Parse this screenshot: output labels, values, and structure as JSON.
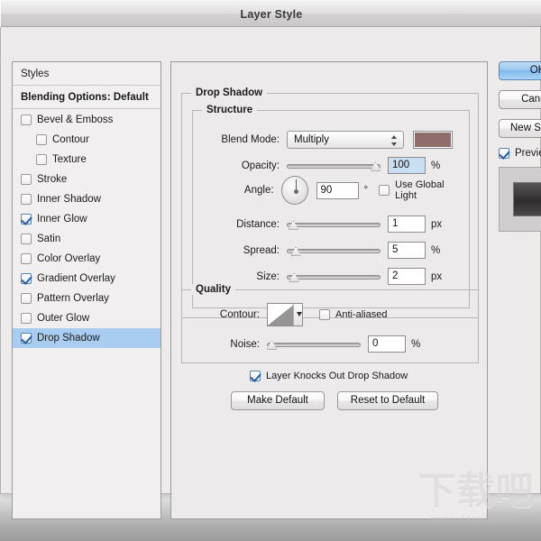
{
  "window": {
    "title": "Layer Style"
  },
  "styles_pane": {
    "header": "Styles",
    "blending_options": "Blending Options: Default",
    "items": [
      {
        "label": "Bevel & Emboss",
        "checked": false,
        "sub": false,
        "selected": false
      },
      {
        "label": "Contour",
        "checked": false,
        "sub": true,
        "selected": false
      },
      {
        "label": "Texture",
        "checked": false,
        "sub": true,
        "selected": false
      },
      {
        "label": "Stroke",
        "checked": false,
        "sub": false,
        "selected": false
      },
      {
        "label": "Inner Shadow",
        "checked": false,
        "sub": false,
        "selected": false
      },
      {
        "label": "Inner Glow",
        "checked": true,
        "sub": false,
        "selected": false
      },
      {
        "label": "Satin",
        "checked": false,
        "sub": false,
        "selected": false
      },
      {
        "label": "Color Overlay",
        "checked": false,
        "sub": false,
        "selected": false
      },
      {
        "label": "Gradient Overlay",
        "checked": true,
        "sub": false,
        "selected": false
      },
      {
        "label": "Pattern Overlay",
        "checked": false,
        "sub": false,
        "selected": false
      },
      {
        "label": "Outer Glow",
        "checked": false,
        "sub": false,
        "selected": false
      },
      {
        "label": "Drop Shadow",
        "checked": true,
        "sub": false,
        "selected": true
      }
    ]
  },
  "main": {
    "section_title": "Drop Shadow",
    "structure": {
      "legend": "Structure",
      "blend_mode": {
        "label": "Blend Mode:",
        "value": "Multiply"
      },
      "color": {
        "hex": "#8f6d6d"
      },
      "opacity": {
        "label": "Opacity:",
        "value": "100",
        "unit": "%",
        "percent": 100
      },
      "angle": {
        "label": "Angle:",
        "value": "90",
        "unit": "°",
        "degrees": 90
      },
      "use_global_light": {
        "label": "Use Global Light",
        "checked": false
      },
      "distance": {
        "label": "Distance:",
        "value": "1",
        "unit": "px",
        "percent": 2
      },
      "spread": {
        "label": "Spread:",
        "value": "5",
        "unit": "%",
        "percent": 5
      },
      "size": {
        "label": "Size:",
        "value": "2",
        "unit": "px",
        "percent": 3
      }
    },
    "quality": {
      "legend": "Quality",
      "contour": {
        "label": "Contour:"
      },
      "anti_aliased": {
        "label": "Anti-aliased",
        "checked": false
      },
      "noise": {
        "label": "Noise:",
        "value": "0",
        "unit": "%",
        "percent": 0
      }
    },
    "layer_knocks_out": {
      "label": "Layer Knocks Out Drop Shadow",
      "checked": true
    },
    "make_default": "Make Default",
    "reset_to_default": "Reset to Default"
  },
  "right_panel": {
    "ok": "OK",
    "cancel": "Cancel",
    "new_style": "New Style...",
    "preview": {
      "label": "Preview",
      "checked": true
    }
  },
  "watermark": {
    "cn": "下载吧",
    "url": "www.xiazaiba.com"
  }
}
